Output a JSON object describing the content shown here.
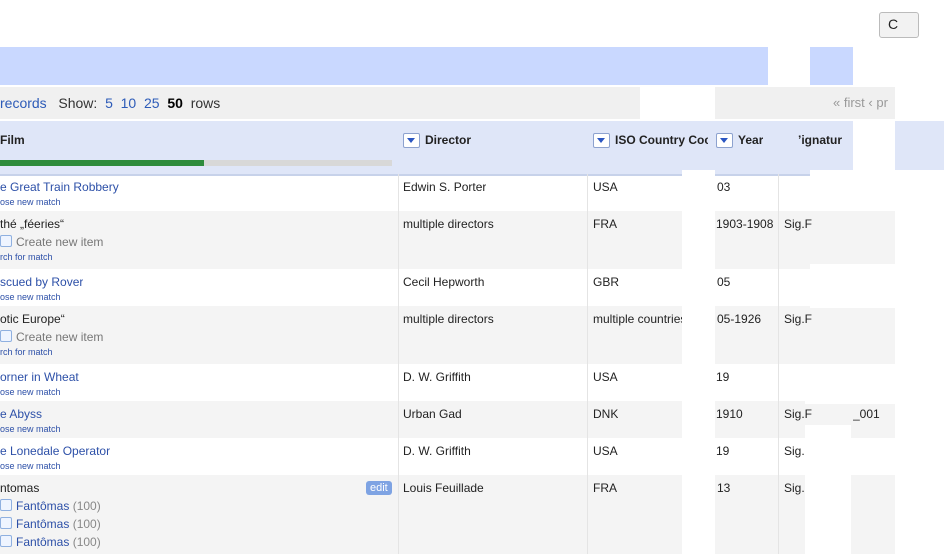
{
  "top_button": "C",
  "rows_bar": {
    "records": "records",
    "show": "Show:",
    "options": [
      "5",
      "10",
      "25"
    ],
    "selected": "50",
    "rows": "rows",
    "pager": "« first ‹ pr"
  },
  "progress": 0.52,
  "columns": [
    "Film",
    "Director",
    "ISO Country Coc",
    "Year",
    "’ignatur"
  ],
  "rows": [
    {
      "film": "e Great Train Robbery",
      "sub": "ose new match",
      "director": "Edwin S. Porter",
      "iso": "USA",
      "year": " 03",
      "sig": ""
    },
    {
      "film": "thé „féeries“",
      "candidates": [
        "Create new item"
      ],
      "sub": "rch for match",
      "director": "multiple directors",
      "iso": "FRA",
      "year": "1903-1908",
      "sig": "Sig.F"
    },
    {
      "film": "scued by Rover",
      "sub": "ose new match",
      "director": "Cecil Hepworth",
      "iso": "GBR",
      "year": " 05",
      "sig": ""
    },
    {
      "film": "otic Europe“",
      "candidates": [
        "Create new item"
      ],
      "sub": "rch for match",
      "director": "multiple directors",
      "iso": "multiple countries",
      "year": " 05-1926",
      "sig": "Sig.F"
    },
    {
      "film": "orner in Wheat",
      "sub": "ose new match",
      "director": "D. W. Griffith",
      "iso": "USA",
      "year": "19",
      "sig": ""
    },
    {
      "film": "e Abyss",
      "sub": "ose new match",
      "director": "Urban Gad",
      "iso": "DNK",
      "year": "1910",
      "sig": "Sig.F",
      "sig_tail": "_001"
    },
    {
      "film": "e Lonedale Operator",
      "sub": "ose new match",
      "director": "D. W. Griffith",
      "iso": "USA",
      "year": "19",
      "sig": "Sig.F"
    },
    {
      "film": "ntomas",
      "edit": "edit",
      "candidates": [
        "Fantômas",
        "Fantômas",
        "Fantômas"
      ],
      "score": "(100)",
      "director": "Louis Feuillade",
      "iso": "FRA",
      "year": " 13",
      "sig": "Sig.F"
    }
  ]
}
